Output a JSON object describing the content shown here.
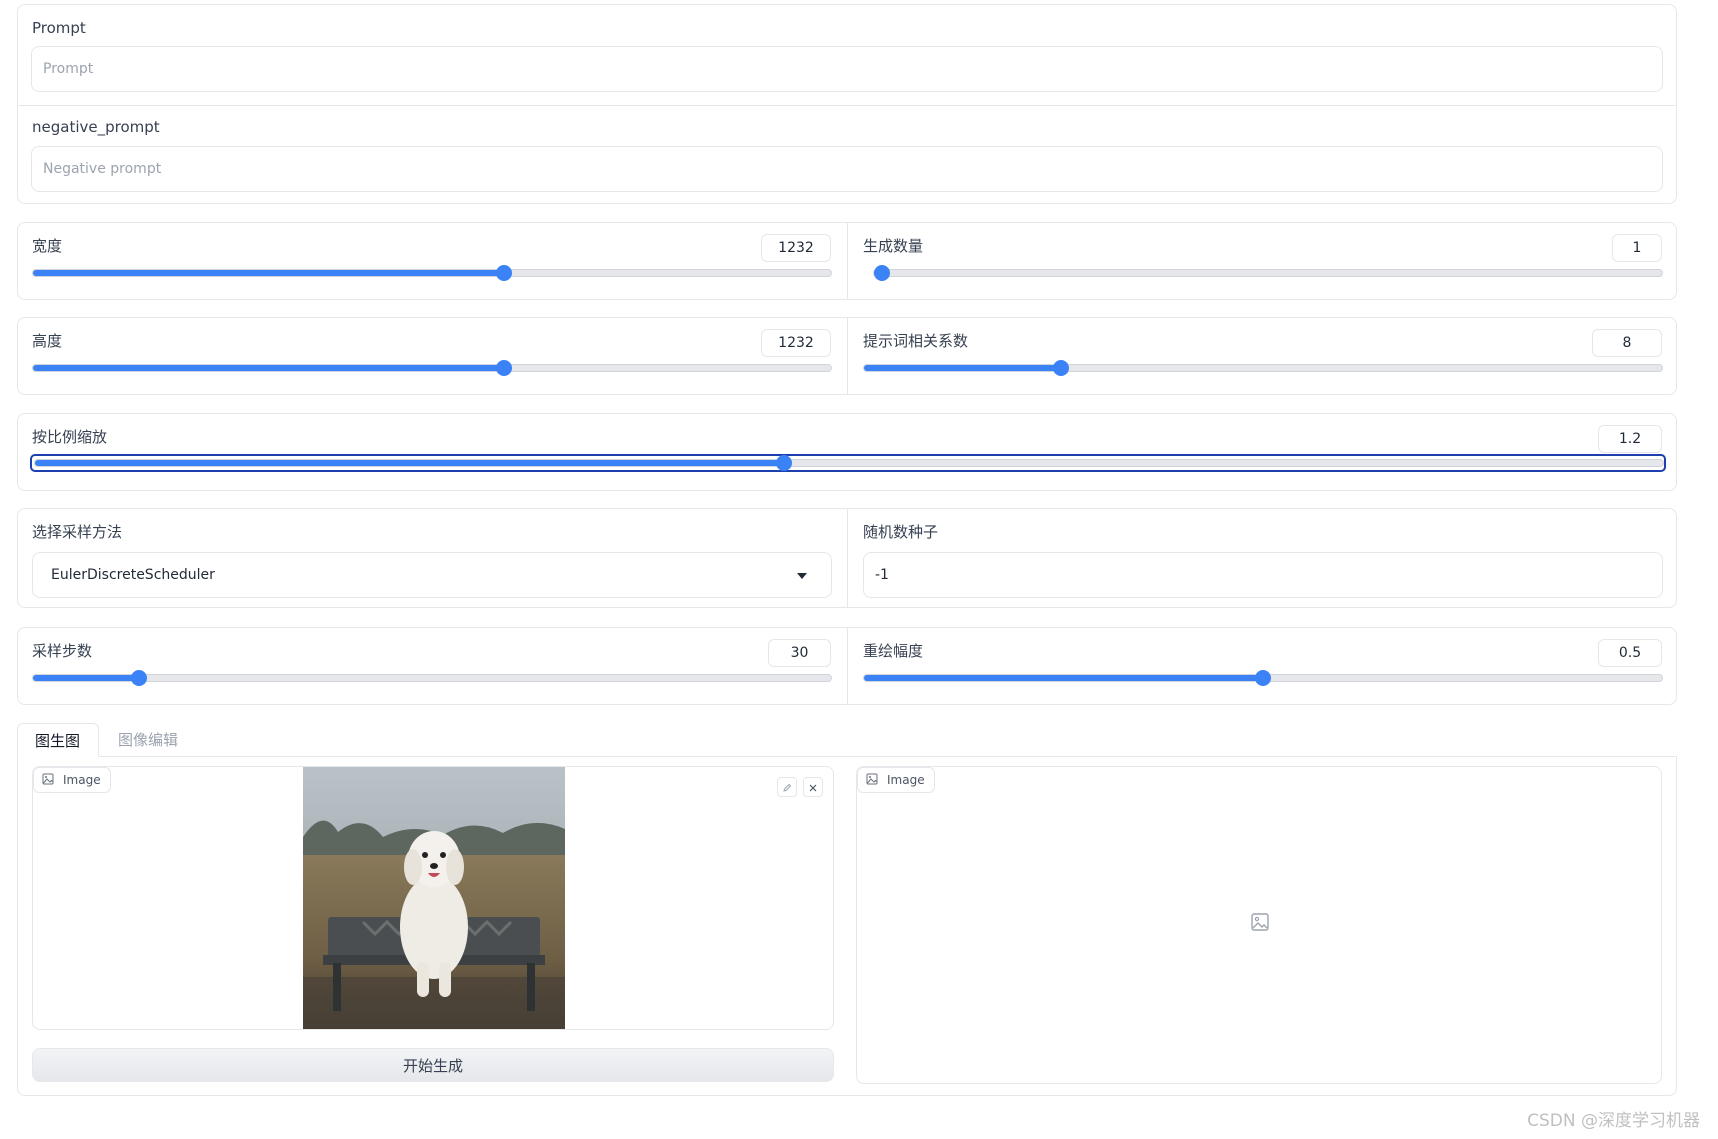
{
  "prompt": {
    "label": "Prompt",
    "placeholder": "Prompt"
  },
  "negative_prompt": {
    "label": "negative_prompt",
    "placeholder": "Negative prompt"
  },
  "width": {
    "label": "宽度",
    "value": "1232",
    "fraction": 0.59
  },
  "num_images": {
    "label": "生成数量",
    "value": "1",
    "fraction": 0.0
  },
  "height": {
    "label": "高度",
    "value": "1232",
    "fraction": 0.59
  },
  "guidance": {
    "label": "提示词相关系数",
    "value": "8",
    "fraction": 0.247
  },
  "scale": {
    "label": "按比例缩放",
    "value": "1.2",
    "fraction": 0.46
  },
  "sampler": {
    "label": "选择采样方法",
    "value": "EulerDiscreteScheduler"
  },
  "seed": {
    "label": "随机数种子",
    "value": "-1"
  },
  "steps": {
    "label": "采样步数",
    "value": "30",
    "fraction": 0.133
  },
  "strength": {
    "label": "重绘幅度",
    "value": "0.5",
    "fraction": 0.5
  },
  "tabs": {
    "active": "图生图",
    "inactive": "图像编辑"
  },
  "input_image": {
    "label": "Image"
  },
  "output_image": {
    "label": "Image"
  },
  "generate_button": "开始生成",
  "colors": {
    "accent": "#3b82f6",
    "border": "#e5e7eb"
  },
  "watermark": "CSDN @深度学习机器"
}
